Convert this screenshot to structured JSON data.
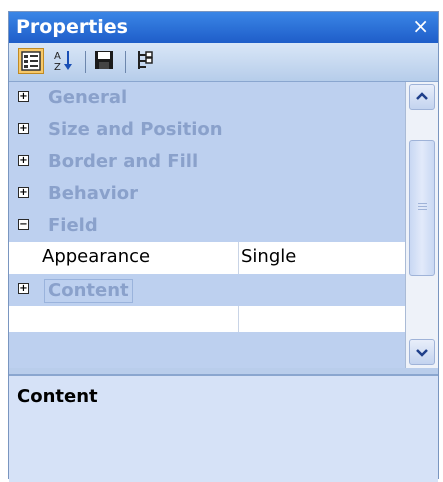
{
  "panel": {
    "title": "Properties",
    "close_symbol": "×"
  },
  "toolbar": {
    "buttons": [
      {
        "icon": "categorized-view-icon",
        "active": true
      },
      {
        "icon": "alphabetical-sort-icon",
        "active": false
      },
      {
        "icon": "save-icon",
        "active": false
      },
      {
        "icon": "hierarchy-icon",
        "active": false
      }
    ]
  },
  "grid": {
    "categories": [
      {
        "label": "General",
        "expanded": false
      },
      {
        "label": "Size and Position",
        "expanded": false
      },
      {
        "label": "Border and Fill",
        "expanded": false
      },
      {
        "label": "Behavior",
        "expanded": false
      },
      {
        "label": "Field",
        "expanded": true
      },
      {
        "label": "Content",
        "expanded": false
      }
    ],
    "properties": [
      {
        "name": "Appearance",
        "value": "Single"
      }
    ],
    "expander_plus": "+",
    "expander_minus": "−"
  },
  "description": {
    "title": "Content"
  },
  "colors": {
    "title_bar": "#1f5dc9",
    "panel_bg": "#b9cdeb",
    "category_text": "#8aa1cb",
    "active_button": "#f7c96a"
  }
}
